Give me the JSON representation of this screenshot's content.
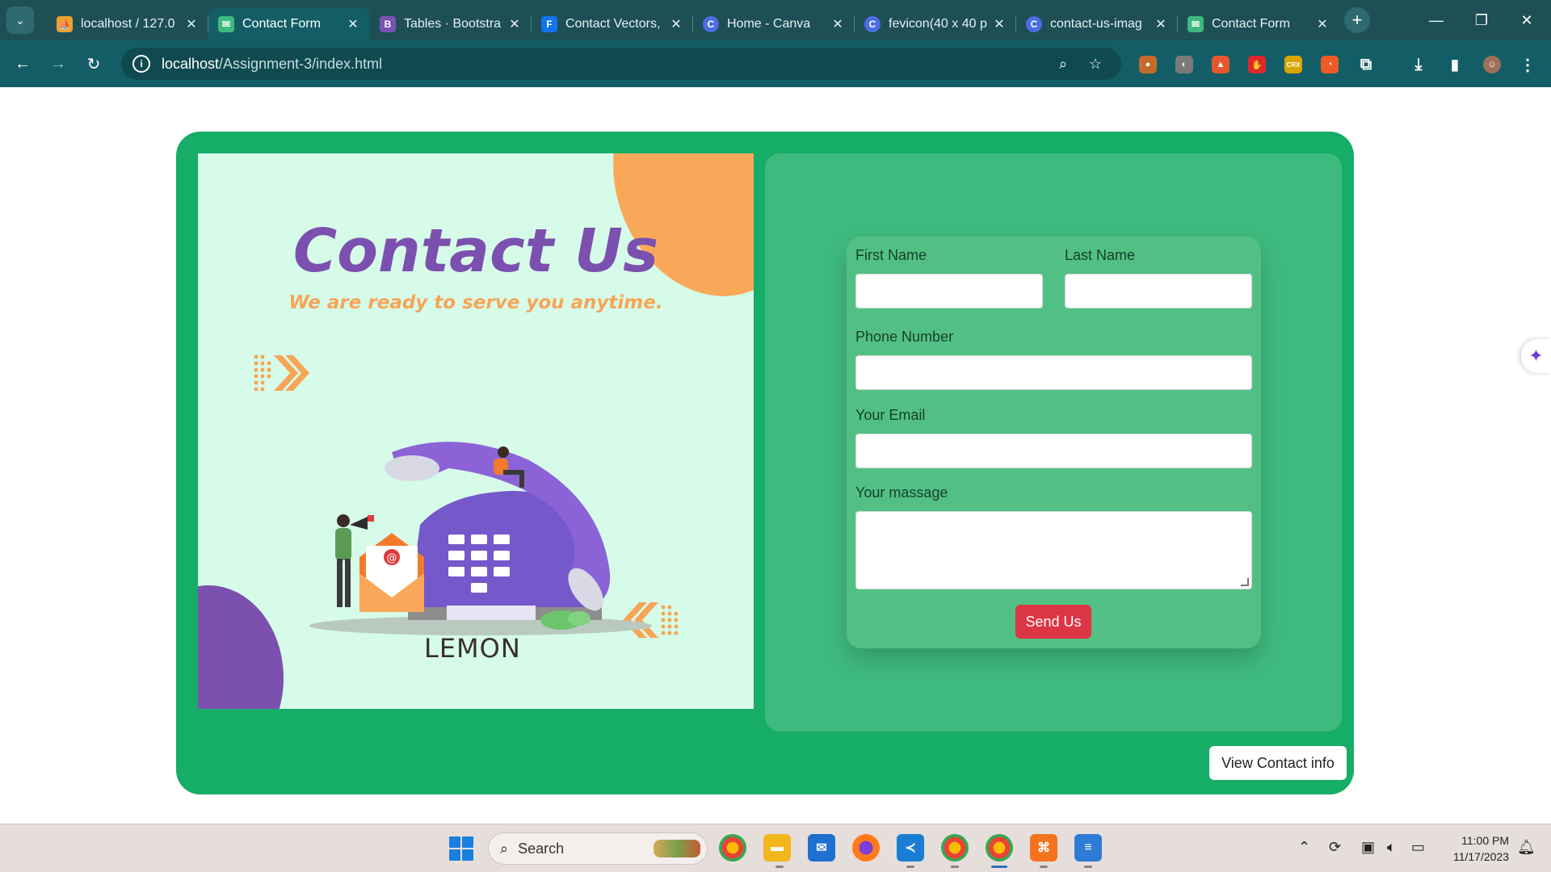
{
  "browser": {
    "tabs": [
      {
        "title": "localhost / 127.0",
        "favicon": "phpmyadmin-icon",
        "color": "#f0a030"
      },
      {
        "title": "Contact Form",
        "favicon": "contact-form-favicon",
        "color": "#3fba7e",
        "active": true
      },
      {
        "title": "Tables · Bootstra",
        "favicon": "bootstrap-icon",
        "color": "#7952b3"
      },
      {
        "title": "Contact Vectors,",
        "favicon": "freepik-icon",
        "color": "#1273eb"
      },
      {
        "title": "Home - Canva",
        "favicon": "canva-icon",
        "color": "#4a6ee0"
      },
      {
        "title": "fevicon(40 x 40 p",
        "favicon": "canva-icon",
        "color": "#4a6ee0"
      },
      {
        "title": "contact-us-imag",
        "favicon": "canva-icon",
        "color": "#4a6ee0"
      },
      {
        "title": "Contact Form",
        "favicon": "contact-form-favicon",
        "color": "#3fba7e"
      }
    ],
    "url": {
      "host": "localhost",
      "path": "/Assignment-3/index.html"
    },
    "extensions": [
      {
        "name": "cookie-extension-icon",
        "color": "#c46a2a",
        "glyph": "●"
      },
      {
        "name": "raccoon-extension-icon",
        "color": "#7a7a7a",
        "glyph": "◐"
      },
      {
        "name": "fire-extension-icon",
        "color": "#e4572e",
        "glyph": "▲"
      },
      {
        "name": "stop-extension-icon",
        "color": "#e0262b",
        "glyph": "✋"
      },
      {
        "name": "crx-extension-icon",
        "color": "#d9a400",
        "glyph": "CRX"
      },
      {
        "name": "postman-extension-icon",
        "color": "#ef5b25",
        "glyph": "◔"
      }
    ]
  },
  "left": {
    "title": "Contact Us",
    "subtitle": "We are ready to serve you anytime.",
    "brand": "LEMON"
  },
  "form": {
    "first_name_label": "First Name",
    "last_name_label": "Last Name",
    "phone_label": "Phone Number",
    "email_label": "Your Email",
    "message_label": "Your massage",
    "first_name_value": "",
    "last_name_value": "",
    "phone_value": "",
    "email_value": "",
    "message_value": "",
    "send_label": "Send Us"
  },
  "view_contact_label": "View Contact info",
  "taskbar": {
    "search_placeholder": "Search",
    "time": "11:00 PM",
    "date": "11/17/2023"
  },
  "colors": {
    "card": "#16ad67",
    "panel": "#3fba7e",
    "title": "#7b50ae",
    "subtitle": "#f7a557",
    "send": "#dc3545"
  }
}
